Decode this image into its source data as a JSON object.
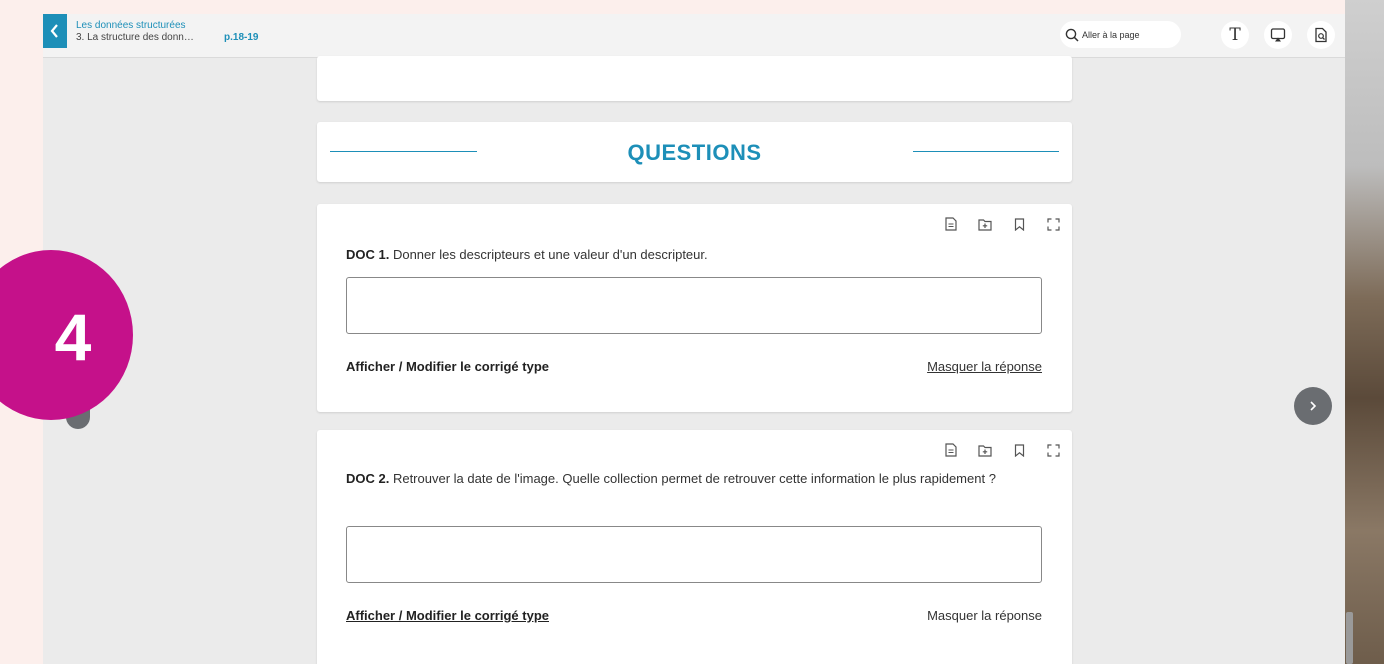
{
  "header": {
    "chapter": "Les données structurées",
    "section": "3. La structure des donn…",
    "pages": "p.18-19",
    "goto_placeholder": "Aller à la page",
    "text_button_label": "T"
  },
  "questions_heading": "QUESTIONS",
  "questions": [
    {
      "label": "DOC 1.",
      "text": " Donner les descripteurs et une valeur d'un descripteur.",
      "answer": "",
      "corrige_label": "Afficher / Modifier le corrigé type",
      "masquer_label": "Masquer la réponse"
    },
    {
      "label": "DOC 2.",
      "text": " Retrouver la date de l'image. Quelle collection permet de retrouver cette information le plus rapidement ?",
      "answer": "",
      "corrige_label": "Afficher / Modifier le corrigé type",
      "masquer_label": "Masquer la réponse"
    }
  ],
  "step_badge": "4",
  "colors": {
    "accent": "#1d8fb8",
    "badge": "#c5118a",
    "page_bg": "#fcefec"
  },
  "icons": [
    "chevron-left-icon",
    "search-icon",
    "text-icon",
    "screen-share-icon",
    "page-search-icon",
    "document-icon",
    "folder-plus-icon",
    "bookmark-icon",
    "fullscreen-icon",
    "chevron-right-icon"
  ]
}
